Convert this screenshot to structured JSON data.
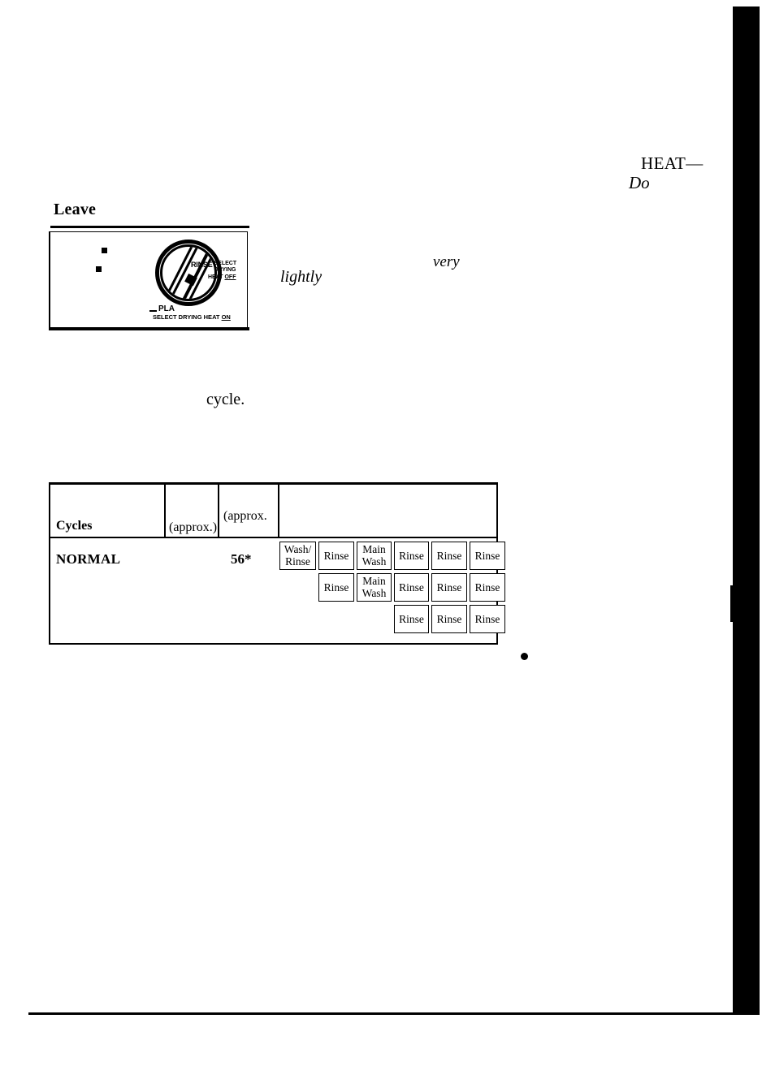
{
  "page": {
    "heading": "Leave",
    "fragments": {
      "heat": "HEAT—",
      "do": "Do",
      "very": "very",
      "lightly": "lightly",
      "cycle": "cycle."
    }
  },
  "dial": {
    "caption_rinse": "RINSE",
    "caption_select": "SELECT",
    "caption_drying": "DRYING",
    "caption_heat": "HEAT ",
    "caption_off": "OFF",
    "caption_plate": "PLA",
    "caption_select_drying_heat": "SELECT DRYING HEAT ",
    "caption_on": "ON"
  },
  "table": {
    "headers": {
      "cycles": "Cycles",
      "col2": "(approx.)",
      "col3": "(approx.",
      "col4": ""
    },
    "rows": [
      {
        "cycle_name": "NORMAL",
        "minutes": "56*",
        "sequence": [
          [
            "Wash/ Rinse",
            "Rinse",
            "Main Wash",
            "Rinse",
            "Rinse",
            "Rinse"
          ],
          [
            "",
            "Rinse",
            "Main Wash",
            "Rinse",
            "Rinse",
            "Rinse"
          ],
          [
            "",
            "",
            "",
            "Rinse",
            "Rinse",
            "Rinse"
          ]
        ]
      }
    ]
  },
  "colors": {
    "ink": "#000000",
    "paper": "#ffffff"
  }
}
